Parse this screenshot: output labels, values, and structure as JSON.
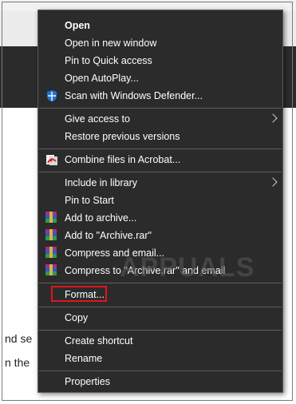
{
  "background": {
    "lines": [
      "nd se",
      "n the"
    ]
  },
  "watermark": {
    "text": "APPUALS"
  },
  "menu": {
    "items": [
      {
        "label": "Open",
        "bold": true,
        "icon": null,
        "arrow": false
      },
      {
        "label": "Open in new window",
        "icon": null
      },
      {
        "label": "Pin to Quick access",
        "icon": null
      },
      {
        "label": "Open AutoPlay...",
        "icon": null
      },
      {
        "label": "Scan with Windows Defender...",
        "icon": "windows-defender-shield-icon"
      },
      {
        "label": "Give access to",
        "icon": null,
        "arrow": true
      },
      {
        "label": "Restore previous versions",
        "icon": null
      },
      {
        "label": "Combine files in Acrobat...",
        "icon": "acrobat-icon"
      },
      {
        "label": "Include in library",
        "icon": null,
        "arrow": true
      },
      {
        "label": "Pin to Start",
        "icon": null
      },
      {
        "label": "Add to archive...",
        "icon": "winrar-icon"
      },
      {
        "label": "Add to \"Archive.rar\"",
        "icon": "winrar-icon"
      },
      {
        "label": "Compress and email...",
        "icon": "winrar-icon"
      },
      {
        "label": "Compress to \"Archive.rar\" and email",
        "icon": "winrar-icon"
      },
      {
        "label": "Format...",
        "icon": null,
        "highlighted": true
      },
      {
        "label": "Copy",
        "icon": null
      },
      {
        "label": "Create shortcut",
        "icon": null
      },
      {
        "label": "Rename",
        "icon": null
      },
      {
        "label": "Properties",
        "icon": null
      }
    ]
  },
  "colors": {
    "menu_bg": "#2b2b2b",
    "menu_text": "#ffffff",
    "separator": "#5e5e5e",
    "highlight_border": "#e0161b"
  }
}
